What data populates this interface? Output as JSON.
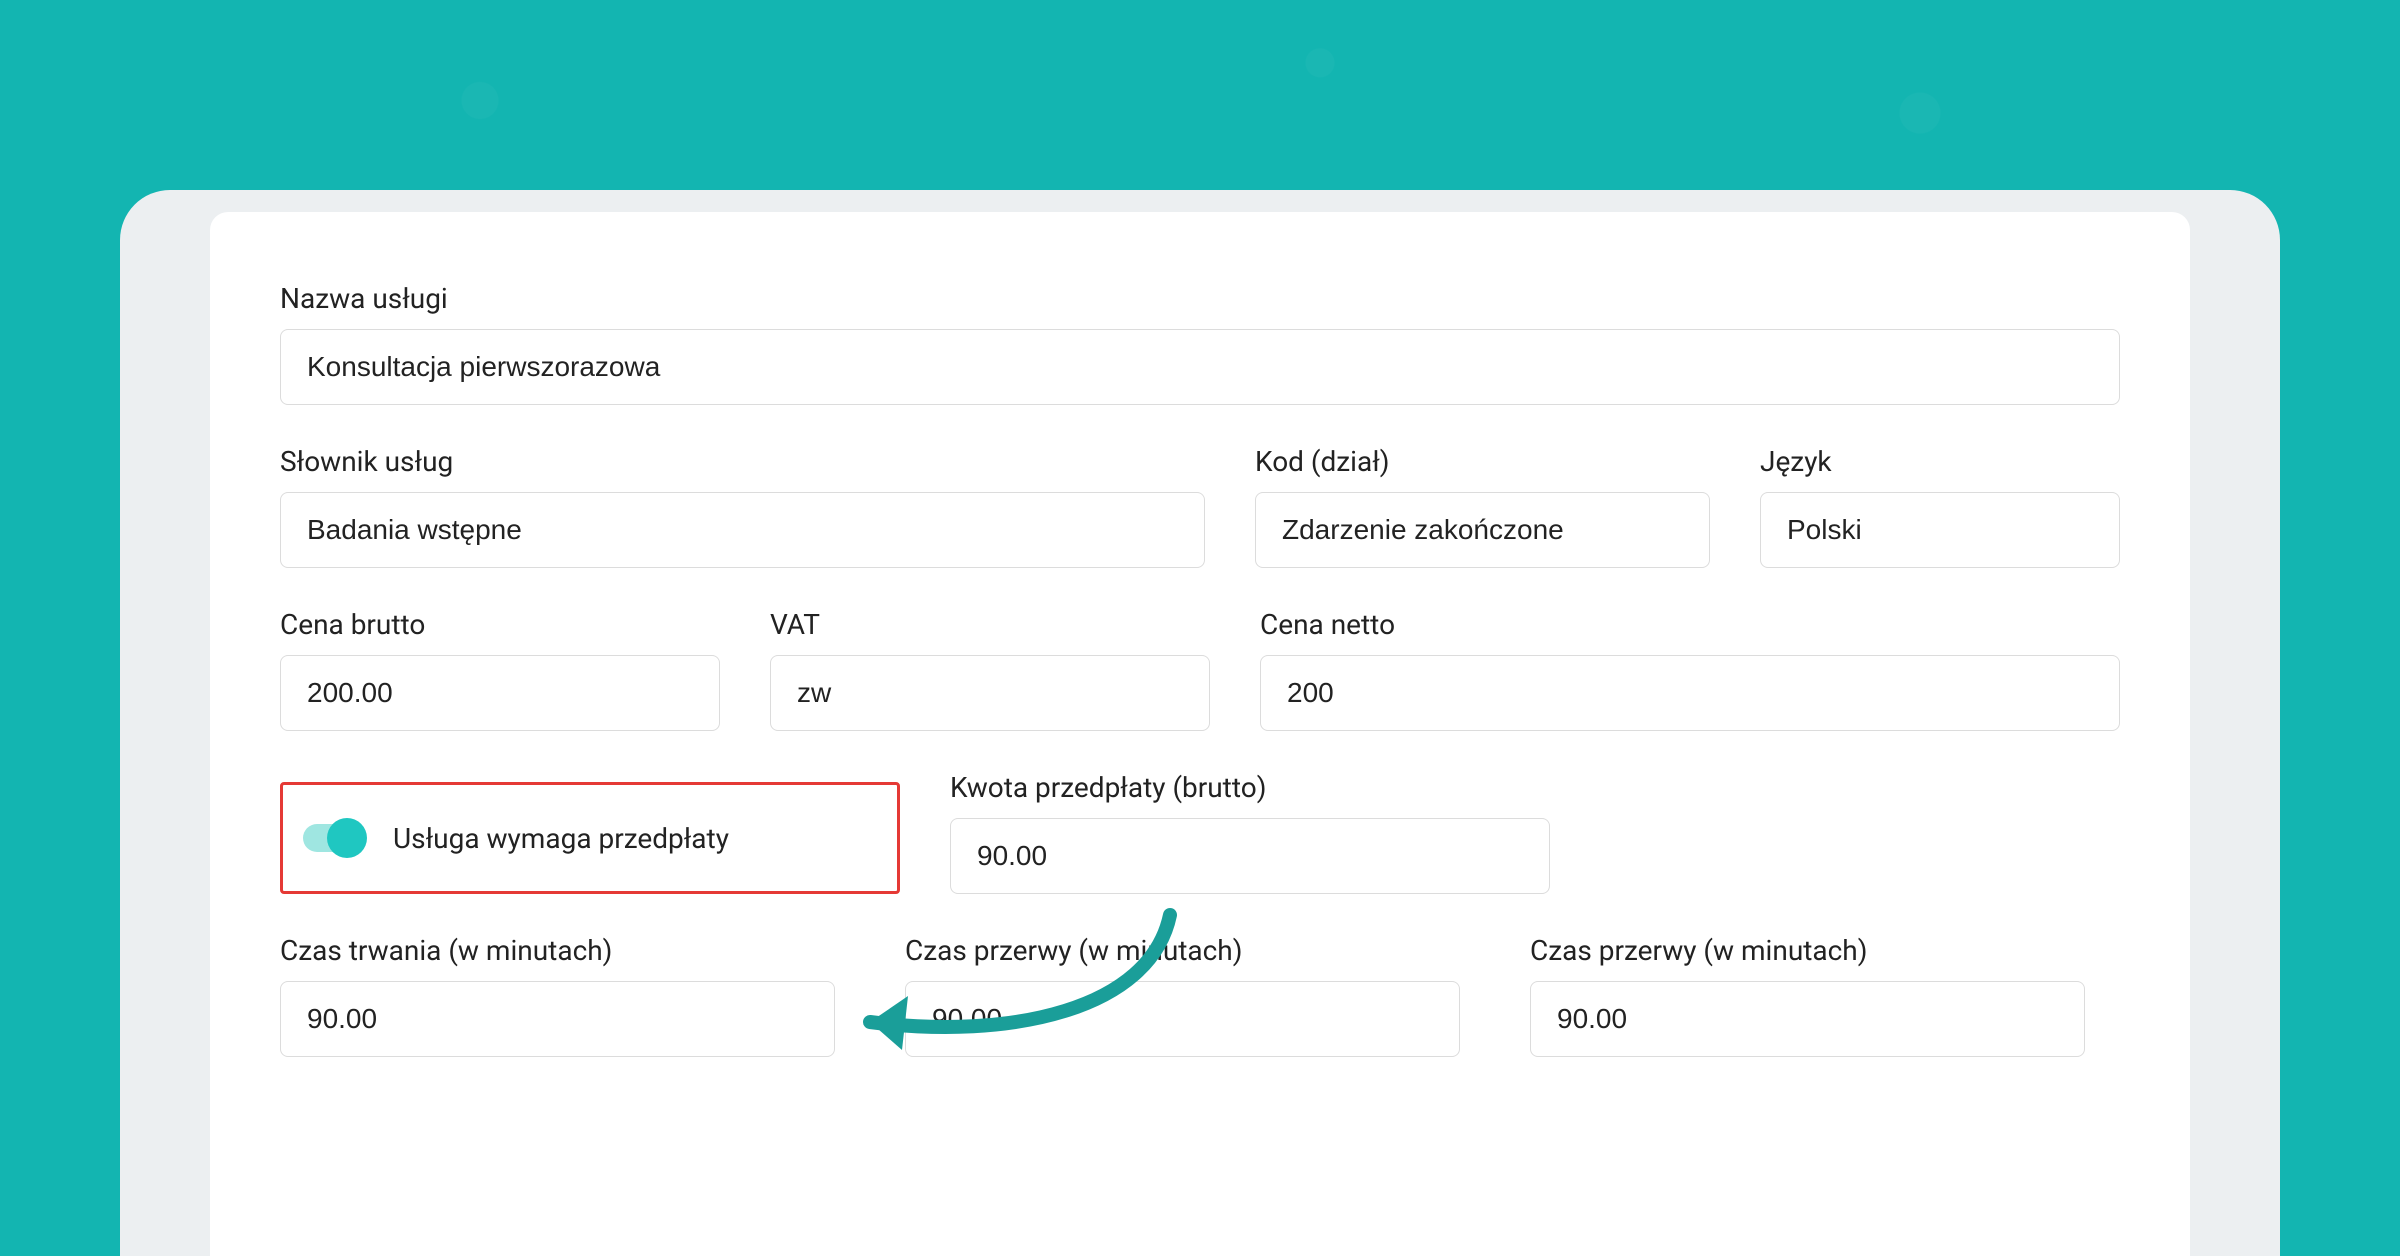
{
  "fields": {
    "serviceName": {
      "label": "Nazwa usługi",
      "value": "Konsultacja pierwszorazowa"
    },
    "dictionary": {
      "label": "Słownik usług",
      "value": "Badania wstępne"
    },
    "code": {
      "label": "Kod (dział)",
      "value": "Zdarzenie zakończone"
    },
    "language": {
      "label": "Język",
      "value": "Polski"
    },
    "priceGross": {
      "label": "Cena brutto",
      "value": "200.00"
    },
    "vat": {
      "label": "VAT",
      "value": "zw"
    },
    "priceNet": {
      "label": "Cena netto",
      "value": "200"
    },
    "prepayAmount": {
      "label": "Kwota przedpłaty (brutto)",
      "value": "90.00"
    },
    "duration": {
      "label": "Czas trwania (w minutach)",
      "value": "90.00"
    },
    "break1": {
      "label": "Czas przerwy (w minutach)",
      "value": "90.00"
    },
    "break2": {
      "label": "Czas przerwy (w minutach)",
      "value": "90.00"
    }
  },
  "toggle": {
    "prepayRequired": {
      "label": "Usługa wymaga przedpłaty",
      "on": true
    }
  },
  "colors": {
    "accent": "#13b5b1",
    "highlightBorder": "#e53935"
  }
}
